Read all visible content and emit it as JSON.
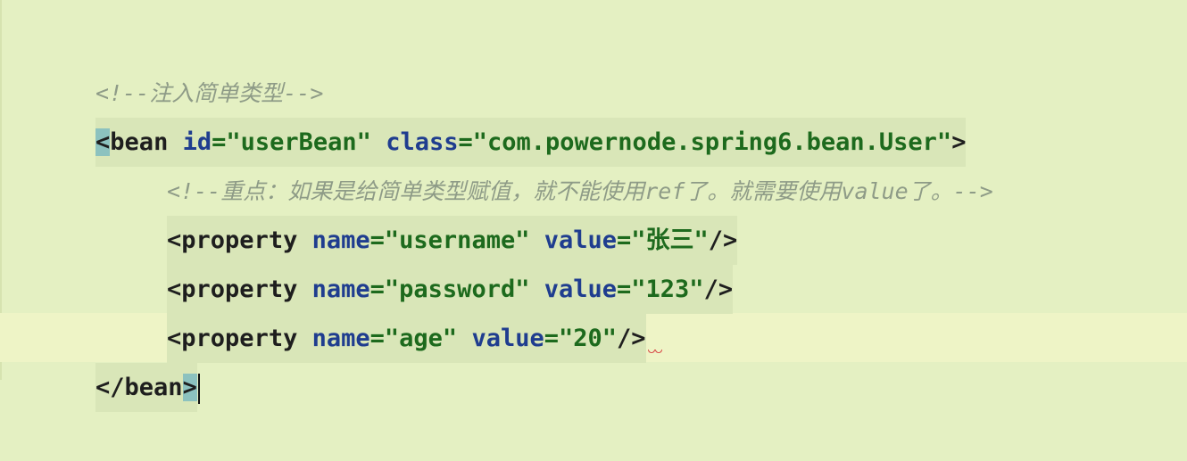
{
  "editor": {
    "lines": {
      "comment1": "<!--注入简单类型-->",
      "bean_open": {
        "lt": "<",
        "tag": "bean",
        "attr_id": "id",
        "eq1": "=",
        "id_value": "\"userBean\"",
        "attr_class": "class",
        "eq2": "=",
        "class_value": "\"com.powernode.spring6.bean.User\"",
        "gt": ">"
      },
      "comment2": "<!--重点：如果是给简单类型赋值，就不能使用ref了。就需要使用value了。-->",
      "prop1": {
        "tag": "<property",
        "attr_name": "name",
        "eq": "=",
        "name_value": "\"username\"",
        "attr_value": "value",
        "value_value": "\"张三\"",
        "close": "/>"
      },
      "prop2": {
        "tag": "<property",
        "attr_name": "name",
        "eq": "=",
        "name_value": "\"password\"",
        "attr_value": "value",
        "value_value": "\"123\"",
        "close": "/>"
      },
      "prop3": {
        "tag": "<property",
        "attr_name": "name",
        "eq": "=",
        "name_value": "\"age\"",
        "attr_value": "value",
        "value_value": "\"20\"",
        "close": "/>"
      },
      "bean_close": {
        "tag": "</bean",
        "gt": ">"
      }
    }
  },
  "colors": {
    "background": "#e4f0c2",
    "attribute": "#1f3d8f",
    "string": "#1d6a1d",
    "comment": "#8e9b87",
    "bracket_highlight": "#8cc2bf"
  }
}
